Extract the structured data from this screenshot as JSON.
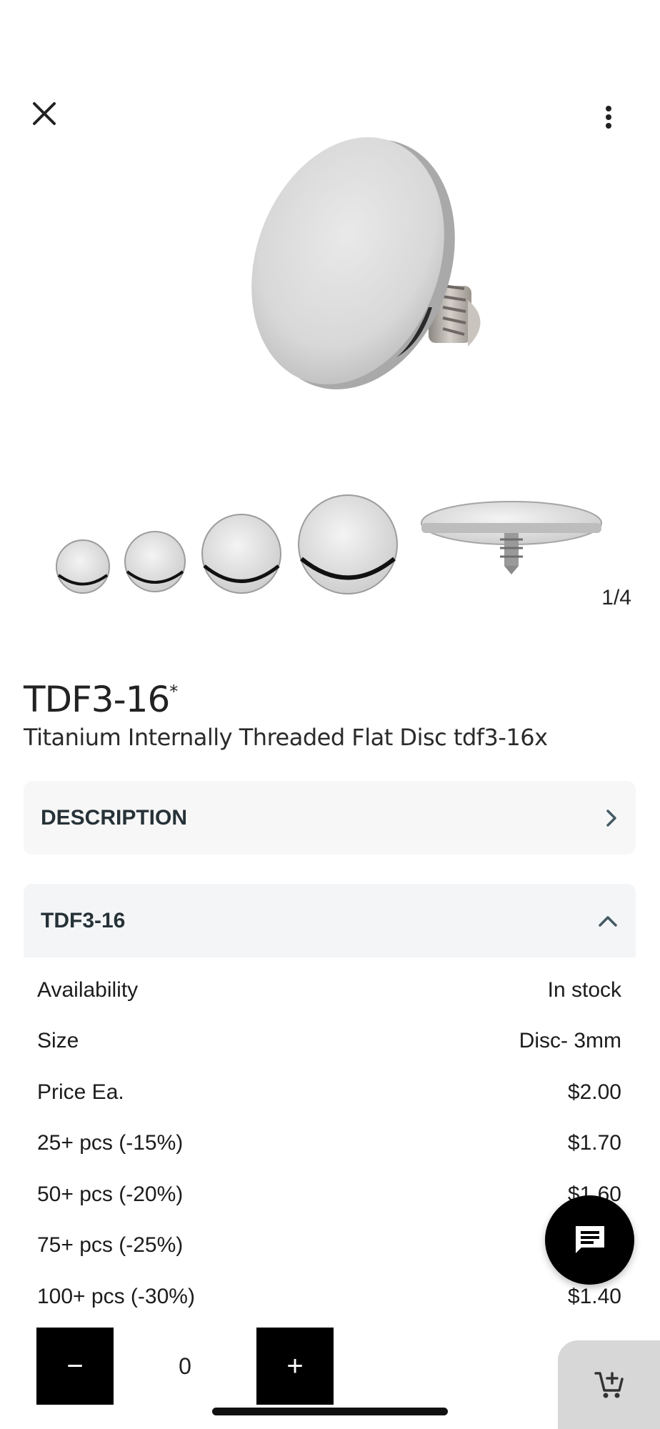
{
  "header": {
    "close_icon": "close-icon",
    "menu_icon": "more-vert-icon"
  },
  "gallery": {
    "counter": "1/4"
  },
  "product": {
    "title": "TDF3-16",
    "title_mark": "*",
    "subtitle": "Titanium Internally Threaded Flat Disc tdf3-16x"
  },
  "accordions": {
    "description_label": "DESCRIPTION",
    "variant_label": "TDF3-16"
  },
  "specs": [
    {
      "label": "Availability",
      "value": "In stock"
    },
    {
      "label": "Size",
      "value": "Disc- 3mm"
    },
    {
      "label": "Price Ea.",
      "value": "$2.00"
    },
    {
      "label": "25+ pcs (-15%)",
      "value": "$1.70"
    },
    {
      "label": "50+ pcs (-20%)",
      "value": "$1.60"
    },
    {
      "label": "75+ pcs (-25%)",
      "value": ""
    },
    {
      "label": "100+ pcs (-30%)",
      "value": "$1.40"
    }
  ],
  "quantity": {
    "minus": "−",
    "value": "0",
    "plus": "+"
  },
  "colors": {
    "accent": "#000000",
    "panel": "#f7f7f7",
    "cart_bg": "#d7d7d7"
  }
}
